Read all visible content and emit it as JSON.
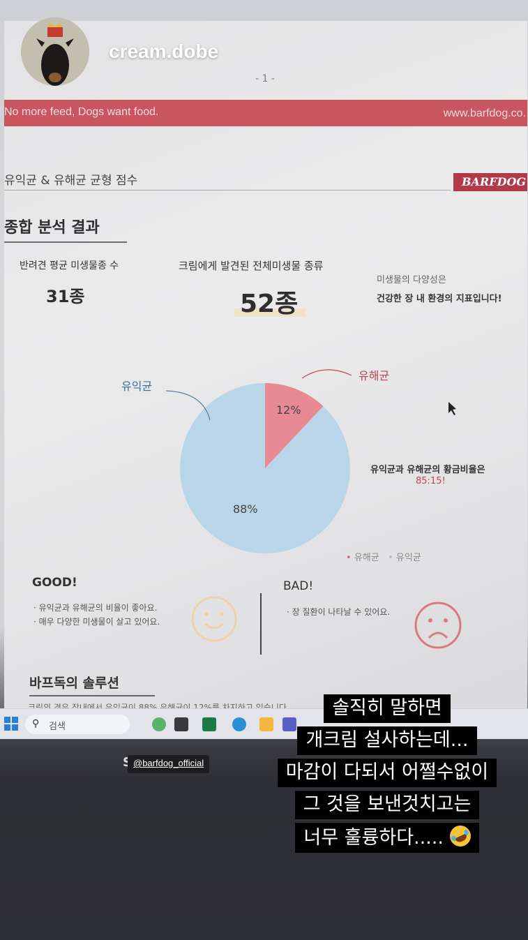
{
  "story": {
    "username": "cream.dobe",
    "mention": "@barfdog_official",
    "mention_prefix": "S",
    "caption_lines": [
      "솔직히 말하면",
      "개크림 설사하는데...",
      "마감이 다되서 어쩔수없이",
      "그 것을 보낸것치고는",
      "너무 훌륭하다....."
    ],
    "caption_emoji": "rofl-emoji-icon"
  },
  "report": {
    "page_number": "- 1 -",
    "banner_left": "No more feed, Dogs want food.",
    "banner_right": "www.barfdog.co.",
    "section_label": "유익균 & 유해균 균형 점수",
    "brand": "BARFDOG",
    "heading": "종합 분석 결과",
    "avg_label": "반려견 평균 미생물종 수",
    "avg_value": "31종",
    "found_label": "크림에게 발견된 전체미생물 종류",
    "found_value": "52종",
    "diversity_label": "미생물의 다양성은",
    "diversity_text": "건강한 장 내 환경의 지표입니다!",
    "ratio_label": "유익균과 유해균의 황금비율은",
    "ratio_value": "85:15!",
    "good_title": "GOOD!",
    "good_items": [
      "· 유익균과 유해균의 비율이 좋아요.",
      "· 매우 다양한 미생물이 살고 있어요."
    ],
    "bad_title": "BAD!",
    "bad_items": [
      "· 장 질환이 나타날 수 있어요."
    ],
    "solution_title": "바프독의 솔루션",
    "solution_text_cut": "크림의 경우 장내에서 유익균이 88% 유해균이 12%를 차지하고 있습니다"
  },
  "chart_data": {
    "type": "pie",
    "categories": [
      "유해균",
      "유익균"
    ],
    "values": [
      12,
      88
    ],
    "slice_labels": [
      "12%",
      "88%"
    ],
    "colors": [
      "#e88a93",
      "#b9d6e8"
    ],
    "legend": [
      "유해균",
      "유익균"
    ],
    "legend_placement": "bottom-right"
  },
  "taskbar": {
    "search_placeholder": "검색",
    "apps": [
      "windows-start-icon",
      "recycle-app-icon",
      "file-explorer-icon",
      "excel-icon",
      "edge-icon",
      "folder-icon",
      "teams-icon"
    ]
  }
}
